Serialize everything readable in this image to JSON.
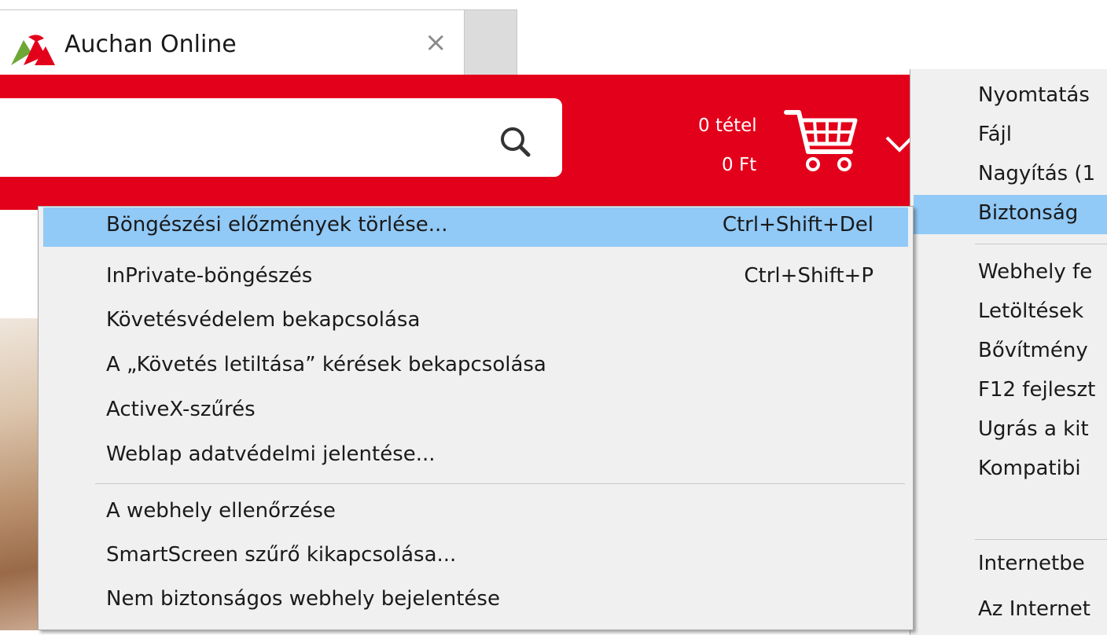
{
  "tab": {
    "title": "Auchan Online",
    "close_symbol": "×"
  },
  "header": {
    "cart_count": "0 tétel",
    "cart_amount": "0 Ft",
    "brand_color": "#e3001b"
  },
  "security_menu": {
    "highlight_color": "#91c9f7",
    "items": [
      {
        "label": "Böngészési előzmények törlése...",
        "shortcut": "Ctrl+Shift+Del",
        "highlighted": true
      },
      {
        "label": "InPrivate-böngészés",
        "shortcut": "Ctrl+Shift+P"
      },
      {
        "label": "Követésvédelem bekapcsolása"
      },
      {
        "label": "A „Követés letiltása” kérések bekapcsolása"
      },
      {
        "label": "ActiveX-szűrés"
      },
      {
        "label": "Weblap adatvédelmi jelentése..."
      },
      {
        "label": "A webhely ellenőrzése"
      },
      {
        "label": "SmartScreen szűrő kikapcsolása..."
      },
      {
        "label": "Nem biztonságos webhely bejelentése"
      }
    ]
  },
  "tools_menu": {
    "items": [
      {
        "label": "Nyomtatás"
      },
      {
        "label": "Fájl"
      },
      {
        "label": "Nagyítás (1"
      },
      {
        "label": "Biztonság",
        "highlighted": true
      },
      {
        "label": "Webhely fe"
      },
      {
        "label": "Letöltések"
      },
      {
        "label": "Bővítmény"
      },
      {
        "label": "F12 fejleszt"
      },
      {
        "label": "Ugrás a kit"
      },
      {
        "label": "Kompatibi"
      },
      {
        "label": "Internetbe"
      },
      {
        "label": "Az Internet"
      }
    ]
  }
}
